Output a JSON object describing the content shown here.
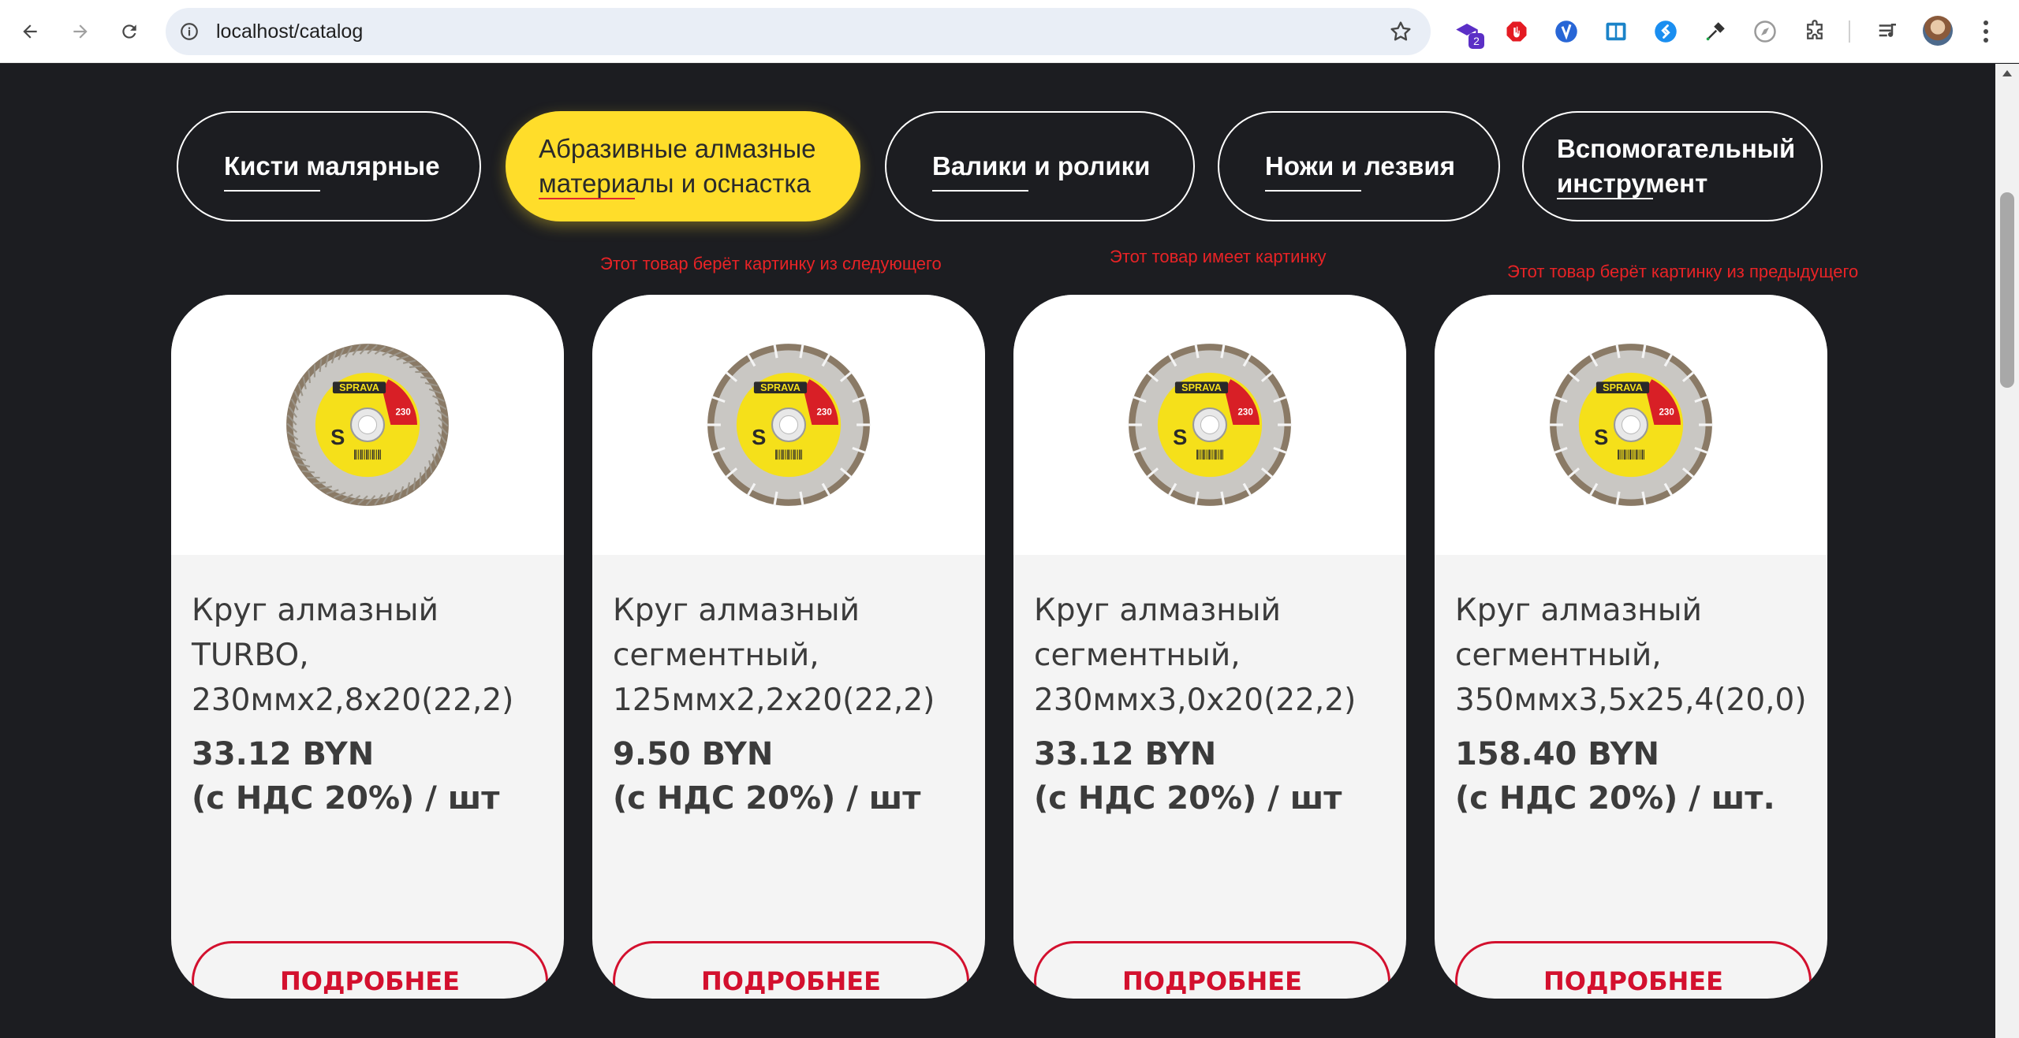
{
  "browser": {
    "url": "localhost/catalog",
    "extension_badge": "2"
  },
  "categories": [
    {
      "label": "Кисти малярные",
      "active": false
    },
    {
      "label": "Абразивные алмазные материалы и оснастка",
      "active": true
    },
    {
      "label": "Валики и ролики",
      "active": false
    },
    {
      "label": "Ножи и лезвия",
      "active": false
    },
    {
      "label": "Вспомогательный инструмент",
      "active": false
    }
  ],
  "notes": [
    "Этот товар берёт картинку из следующего",
    "Этот товар имеет картинку",
    "Этот товар берёт картинку из предыдущего"
  ],
  "products": [
    {
      "name_lines": [
        "Круг алмазный",
        "TURBO,",
        "230ммх2,8х20(22,2)"
      ],
      "price": "33.12 BYN",
      "price_note": "(с НДС 20%) / шт",
      "button": "ПОДРОБНЕЕ",
      "image": "turbo-diamond-disc"
    },
    {
      "name_lines": [
        "Круг алмазный",
        "сегментный,",
        "125ммх2,2х20(22,2)"
      ],
      "price": "9.50 BYN",
      "price_note": "(с НДС 20%) / шт",
      "button": "ПОДРОБНЕЕ",
      "image": "segmented-diamond-disc"
    },
    {
      "name_lines": [
        "Круг алмазный",
        "сегментный,",
        "230ммх3,0х20(22,2)"
      ],
      "price": "33.12 BYN",
      "price_note": "(с НДС 20%) / шт",
      "button": "ПОДРОБНЕЕ",
      "image": "segmented-diamond-disc"
    },
    {
      "name_lines": [
        "Круг алмазный",
        "сегментный,",
        "350ммх3,5х25,4(20,0)"
      ],
      "price": "158.40 BYN",
      "price_note": "(с НДС 20%) / шт.",
      "button": "ПОДРОБНЕЕ",
      "image": "segmented-diamond-disc"
    }
  ],
  "disc_label": {
    "brand": "SPRAVA",
    "size": "230",
    "letter": "S"
  },
  "colors": {
    "page_bg": "#1c1d21",
    "active_pill": "#ffdd2a",
    "accent_red": "#d3102e",
    "note_red": "#e82326"
  }
}
